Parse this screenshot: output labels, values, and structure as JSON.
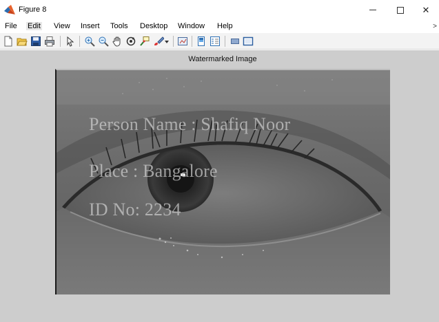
{
  "window": {
    "title": "Figure 8",
    "controls": {
      "minimize": "—",
      "maximize": "□",
      "close": "✕"
    }
  },
  "menu": {
    "items": [
      "File",
      "Edit",
      "View",
      "Insert",
      "Tools",
      "Desktop",
      "Window",
      "Help"
    ],
    "active": "Edit",
    "overflow_glyph": "˃"
  },
  "toolbar": {
    "icons": [
      "new-figure-icon",
      "open-file-icon",
      "save-figure-icon",
      "print-figure-icon",
      "edit-plot-icon",
      "zoom-in-icon",
      "zoom-out-icon",
      "pan-icon",
      "rotate-3d-icon",
      "data-cursor-icon",
      "brush-icon",
      "link-plot-icon",
      "insert-colorbar-icon",
      "insert-legend-icon",
      "hide-plot-tools-icon",
      "show-plot-tools-icon"
    ]
  },
  "figure": {
    "plot_title": "Watermarked Image",
    "background_color": "#cdcdcd",
    "watermark": {
      "name_line": "Person Name :   Shafiq Noor",
      "place_line": "Place : Bangalore",
      "id_line": "ID No: 2234"
    }
  },
  "colors": {
    "matlab_logo_orange": "#e8622c",
    "matlab_logo_blue": "#2b6cb0"
  }
}
